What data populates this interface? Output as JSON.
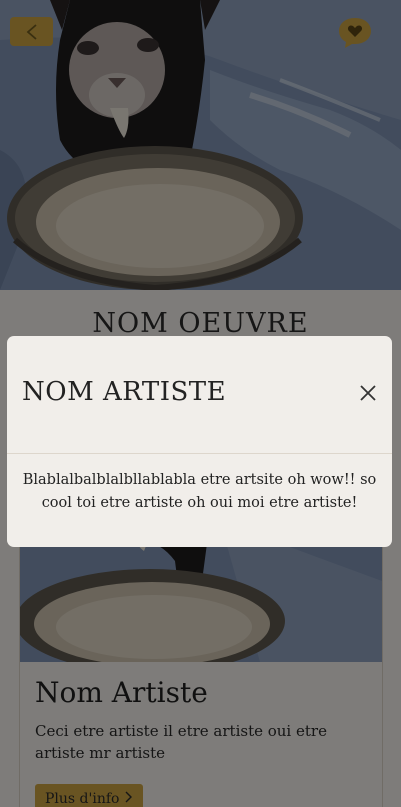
{
  "page": {
    "oeuvre_title": "NOM OEUVRE"
  },
  "header": {
    "back_icon": "chevron-left-icon",
    "chat_icon": "chat-heart-icon",
    "accent_color": "#c9a142"
  },
  "artist_card": {
    "name": "Nom Artiste",
    "description": "Ceci etre artiste il etre artiste oui etre artiste mr artiste",
    "more_label": "Plus d'info",
    "more_icon": "chevron-right-icon"
  },
  "modal": {
    "title": "NOM ARTISTE",
    "close_icon": "close-icon",
    "body": "Blablalbalblalbllablabla etre artsite oh wow!! so cool toi etre artiste oh oui moi etre artiste!"
  }
}
